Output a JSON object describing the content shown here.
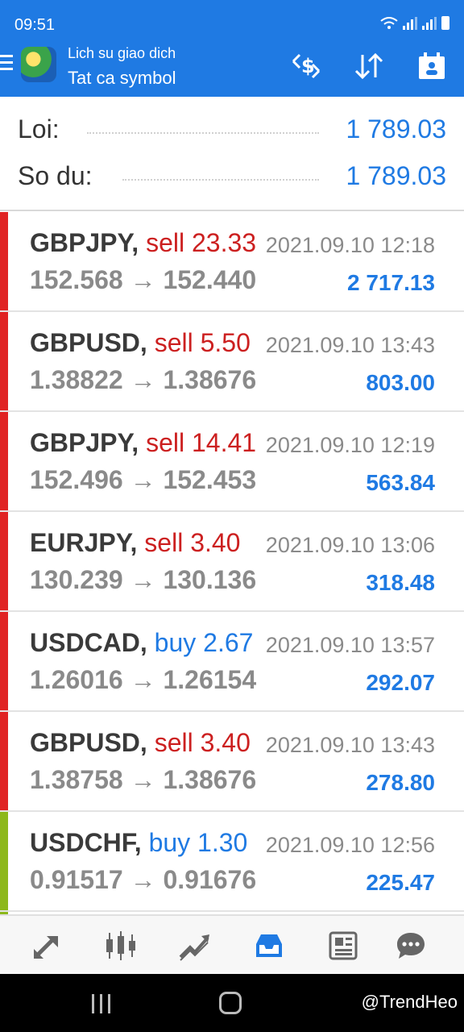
{
  "status": {
    "time": "09:51"
  },
  "header": {
    "subtitle": "Lich su giao dich",
    "title": "Tat ca symbol"
  },
  "summary": {
    "profit_label": "Loi:",
    "profit_value": "1 789.03",
    "balance_label": "So du:",
    "balance_value": "1 789.03"
  },
  "trades": [
    {
      "symbol": "GBPJPY,",
      "side": "sell",
      "volume": "23.33",
      "time": "2021.09.10 12:18",
      "open": "152.568",
      "close": "152.440",
      "profit": "2 717.13",
      "stripe": "#e02424"
    },
    {
      "symbol": "GBPUSD,",
      "side": "sell",
      "volume": "5.50",
      "time": "2021.09.10 13:43",
      "open": "1.38822",
      "close": "1.38676",
      "profit": "803.00",
      "stripe": "#e02424"
    },
    {
      "symbol": "GBPJPY,",
      "side": "sell",
      "volume": "14.41",
      "time": "2021.09.10 12:19",
      "open": "152.496",
      "close": "152.453",
      "profit": "563.84",
      "stripe": "#e02424"
    },
    {
      "symbol": "EURJPY,",
      "side": "sell",
      "volume": "3.40",
      "time": "2021.09.10 13:06",
      "open": "130.239",
      "close": "130.136",
      "profit": "318.48",
      "stripe": "#e02424"
    },
    {
      "symbol": "USDCAD,",
      "side": "buy",
      "volume": "2.67",
      "time": "2021.09.10 13:57",
      "open": "1.26016",
      "close": "1.26154",
      "profit": "292.07",
      "stripe": "#e02424"
    },
    {
      "symbol": "GBPUSD,",
      "side": "sell",
      "volume": "3.40",
      "time": "2021.09.10 13:43",
      "open": "1.38758",
      "close": "1.38676",
      "profit": "278.80",
      "stripe": "#e02424"
    },
    {
      "symbol": "USDCHF,",
      "side": "buy",
      "volume": "1.30",
      "time": "2021.09.10 12:56",
      "open": "0.91517",
      "close": "0.91676",
      "profit": "225.47",
      "stripe": "#8db81c"
    }
  ],
  "arrow": "→",
  "watermark": "@TrendHeo",
  "colors": {
    "accent": "#1f7ae3",
    "sell": "#cc2020",
    "loss_stripe": "#e02424",
    "profit_stripe": "#8db81c"
  }
}
